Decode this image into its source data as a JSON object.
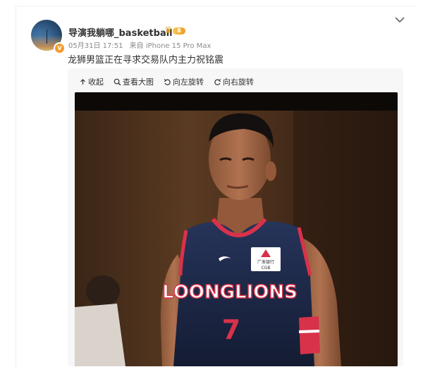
{
  "post": {
    "username": "导演我躺哪_basketball",
    "vip_level": "8",
    "verified_mark": "V",
    "date": "05月31日 17:51",
    "source": "来自 iPhone 15 Pro Max",
    "text": "龙狮男篮正在寻求交易队内主力祝铭震"
  },
  "toolbar": {
    "collapse": "收起",
    "view_large": "查看大图",
    "rotate_left": "向左旋转",
    "rotate_right": "向右旋转"
  },
  "photo": {
    "jersey_text": "LOONGLIONS",
    "jersey_number": "7",
    "sponsor": "广发银行",
    "sponsor_code": "CGB"
  },
  "colors": {
    "jersey": "#1d2a4a",
    "accent_red": "#d8324a",
    "vip_gold": "#f29b1e"
  }
}
